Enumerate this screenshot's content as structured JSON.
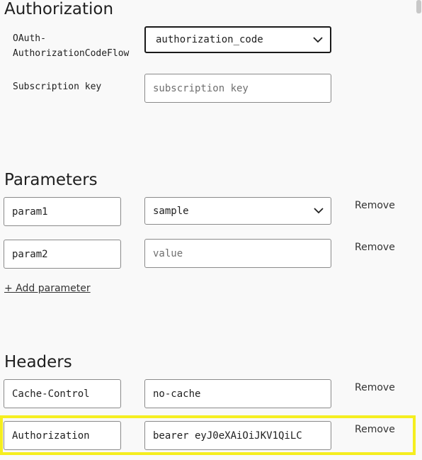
{
  "authorization": {
    "title": "Authorization",
    "flow_label": "OAuth-\nAuthorizationCodeFlow",
    "flow_value": "authorization_code",
    "subscription_label": "Subscription key",
    "subscription_placeholder": "subscription key"
  },
  "parameters": {
    "title": "Parameters",
    "rows": [
      {
        "name": "param1",
        "value": "sample",
        "value_is_placeholder": false,
        "is_select": true
      },
      {
        "name": "param2",
        "value": "value",
        "value_is_placeholder": true,
        "is_select": false
      }
    ],
    "add_label": "+ Add parameter"
  },
  "headers": {
    "title": "Headers",
    "rows": [
      {
        "name": "Cache-Control",
        "value": "no-cache"
      },
      {
        "name": "Authorization",
        "value": "bearer eyJ0eXAiOiJKV1QiLC"
      }
    ]
  },
  "remove_label": "Remove",
  "colors": {
    "highlight": "#f5ee1f",
    "border": "#8a8a8a",
    "background": "#f9f9f9"
  }
}
